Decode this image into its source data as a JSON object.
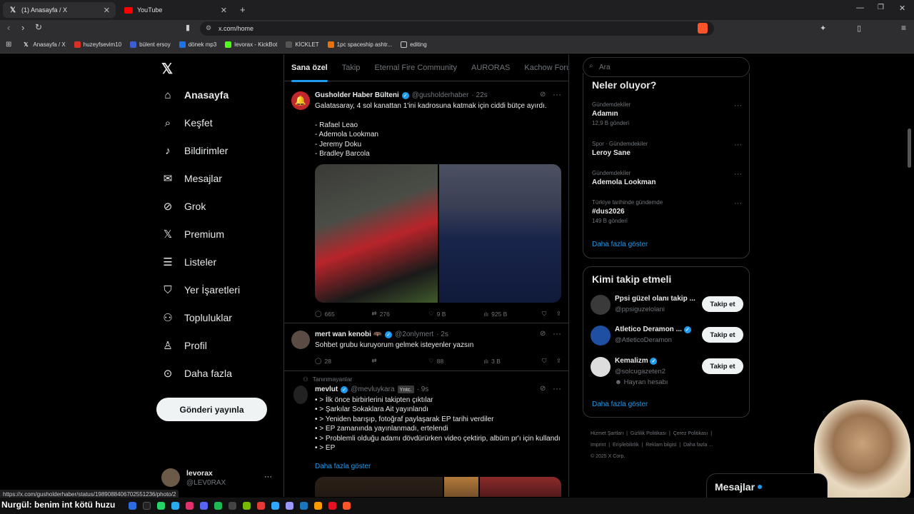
{
  "browser": {
    "tabs": [
      {
        "title": "(1) Anasayfa / X",
        "active": true
      },
      {
        "title": "YouTube",
        "active": false
      }
    ],
    "url": "x.com/home",
    "bookmarks": [
      "Anasayfa / X",
      "huzeyfsevim10",
      "bülent ersoy",
      "dönek mp3",
      "levorax - KickBot",
      "KİCKLET",
      "1pc spaceship ashtr...",
      "editing"
    ],
    "status_url": "https://x.com/gusholderhaber/status/1989088406702551236/photo/2"
  },
  "nav": {
    "items": [
      "Anasayfa",
      "Keşfet",
      "Bildirimler",
      "Mesajlar",
      "Grok",
      "Premium",
      "Listeler",
      "Yer İşaretleri",
      "Topluluklar",
      "Profil",
      "Daha fazla"
    ],
    "post_button": "Gönderi yayınla",
    "profile_name": "levorax",
    "profile_handle": "@LEV0RAX"
  },
  "feed": {
    "tabs": [
      "Sana özel",
      "Takip",
      "Eternal Fire Community",
      "AURORAS",
      "Kachow Forum"
    ],
    "tweets": [
      {
        "name": "Gusholder Haber Bülteni",
        "handle": "@gusholderhaber",
        "time": "· 22s",
        "text": "Galatasaray, 4 sol kanattan 1'ini kadrosuna katmak için ciddi bütçe ayırdı.\n\n- Rafael Leao\n- Ademola Lookman\n- Jeremy Doku\n- Bradley Barcola",
        "replies": "665",
        "retweets": "276",
        "likes": "9 B",
        "views": "925 B"
      },
      {
        "name": "mert wan kenobi 🦇",
        "handle": "@2onlymert",
        "time": "· 2s",
        "text": "Sohbet grubu kuruyorum gelmek isteyenler yazsın",
        "replies": "28",
        "retweets": "",
        "likes": "88",
        "views": "3 B"
      },
      {
        "context": "Tanınmayanlar",
        "name": "mevlut",
        "handle": "@mevluykara",
        "tag": "Yntc.",
        "time": "· 9s",
        "text": "• > İlk önce birbirlerini takipten çıktılar\n• > Şarkılar Sokaklara Ait yayınlandı\n• > Yeniden barışıp, fotoğraf paylaşarak EP tarihi verdiler\n• > EP zamanında yayınlanmadı, ertelendi\n• > Problemli olduğu adamı dövdürürken video çektirip, albüm pr'ı için kullandı\n• > EP",
        "show_more": "Daha fazla göster"
      }
    ]
  },
  "right": {
    "search_placeholder": "Ara",
    "trends_title": "Neler oluyor?",
    "trends": [
      {
        "context": "Gündemdekiler",
        "title": "Adamın",
        "count": "12,9 B gönderi"
      },
      {
        "context": "Spor · Gündemdekiler",
        "title": "Leroy Sane",
        "count": ""
      },
      {
        "context": "Gündemdekiler",
        "title": "Ademola Lookman",
        "count": ""
      },
      {
        "context": "Türkiye tarihinde gündemde",
        "title": "#dus2026",
        "count": "149 B gönderi"
      }
    ],
    "trends_more": "Daha fazla göster",
    "who_title": "Kimi takip etmeli",
    "who": [
      {
        "name": "Ppsi güzel olanı takip ...",
        "handle": "@ppsiguzelolani",
        "extra": ""
      },
      {
        "name": "Atletico Deramon ...",
        "handle": "@AtleticoDeramon",
        "extra": ""
      },
      {
        "name": "Kemalizm",
        "handle": "@solcugazeten2",
        "extra": "Hayran hesabı"
      }
    ],
    "follow_label": "Takip et",
    "who_more": "Daha fazla göster",
    "footer": [
      "Hizmet Şartları",
      "Gizlilik Politikası",
      "Çerez Politikası",
      "Imprint",
      "Erişilebilirlik",
      "Reklam bilgisi",
      "Daha fazla ...",
      "© 2025 X Corp."
    ]
  },
  "dm_label": "Mesajlar",
  "overlay_text": "Nurgül: benim int kötü huzu",
  "colors": {
    "accent": "#1d9bf0",
    "bg": "#000000",
    "border": "#2f3336",
    "muted": "#71767b"
  }
}
